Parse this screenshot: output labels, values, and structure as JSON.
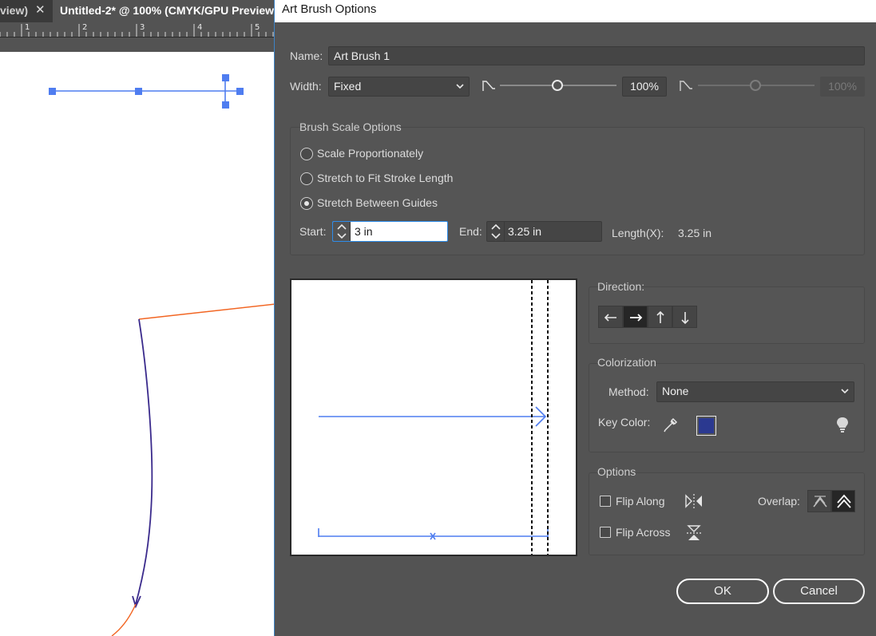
{
  "document": {
    "prev_tab_label": "view)",
    "active_tab_label": "Untitled-2* @ 100% (CMYK/GPU Preview",
    "ruler_numbers": [
      "1",
      "2",
      "3",
      "4",
      "5"
    ]
  },
  "dialog": {
    "title": "Art Brush Options",
    "name_label": "Name:",
    "name_value": "Art Brush 1",
    "width_label": "Width:",
    "width_value": "Fixed",
    "width_percent": "100%",
    "width_percent_max": "100%",
    "scale_group": {
      "title": "Brush Scale Options",
      "options": [
        "Scale Proportionately",
        "Stretch to Fit Stroke Length",
        "Stretch Between Guides"
      ],
      "selected_index": 2,
      "start_label": "Start:",
      "start_value": "3 in",
      "end_label": "End:",
      "end_value": "3.25 in",
      "length_label": "Length(X):",
      "length_value": "3.25 in"
    },
    "direction": {
      "title": "Direction:",
      "buttons": [
        "left-arrow",
        "right-arrow",
        "up-arrow",
        "down-arrow"
      ],
      "active": "right-arrow"
    },
    "colorization": {
      "title": "Colorization",
      "method_label": "Method:",
      "method_value": "None",
      "key_color_label": "Key Color:",
      "key_color": "#2b3990"
    },
    "options": {
      "title": "Options",
      "flip_along_label": "Flip Along",
      "flip_across_label": "Flip Across",
      "flip_along_checked": false,
      "flip_across_checked": false,
      "overlap_label": "Overlap:"
    },
    "ok_label": "OK",
    "cancel_label": "Cancel",
    "colors": {
      "selection_blue": "#4f7df0",
      "path_orange": "#f26522",
      "path_purple": "#3a2a8c"
    }
  }
}
